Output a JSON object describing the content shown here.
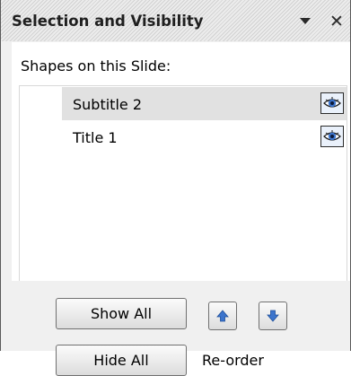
{
  "pane": {
    "title": "Selection and Visibility",
    "section_label": "Shapes on this Slide:"
  },
  "shapes": [
    {
      "name": "Subtitle 2",
      "selected": true,
      "visible": true,
      "visibility_icon": "eye-icon"
    },
    {
      "name": "Title 1",
      "selected": false,
      "visible": true,
      "visibility_icon": "eye-icon"
    }
  ],
  "buttons": {
    "show_all": "Show All",
    "hide_all": "Hide All",
    "reorder_label": "Re-order",
    "move_up_icon": "arrow-up-icon",
    "move_down_icon": "arrow-down-icon"
  },
  "colors": {
    "selected_row": "#e1e1e1",
    "panel_background": "#f0f0f0",
    "arrow_blue": "#3c74cc"
  }
}
